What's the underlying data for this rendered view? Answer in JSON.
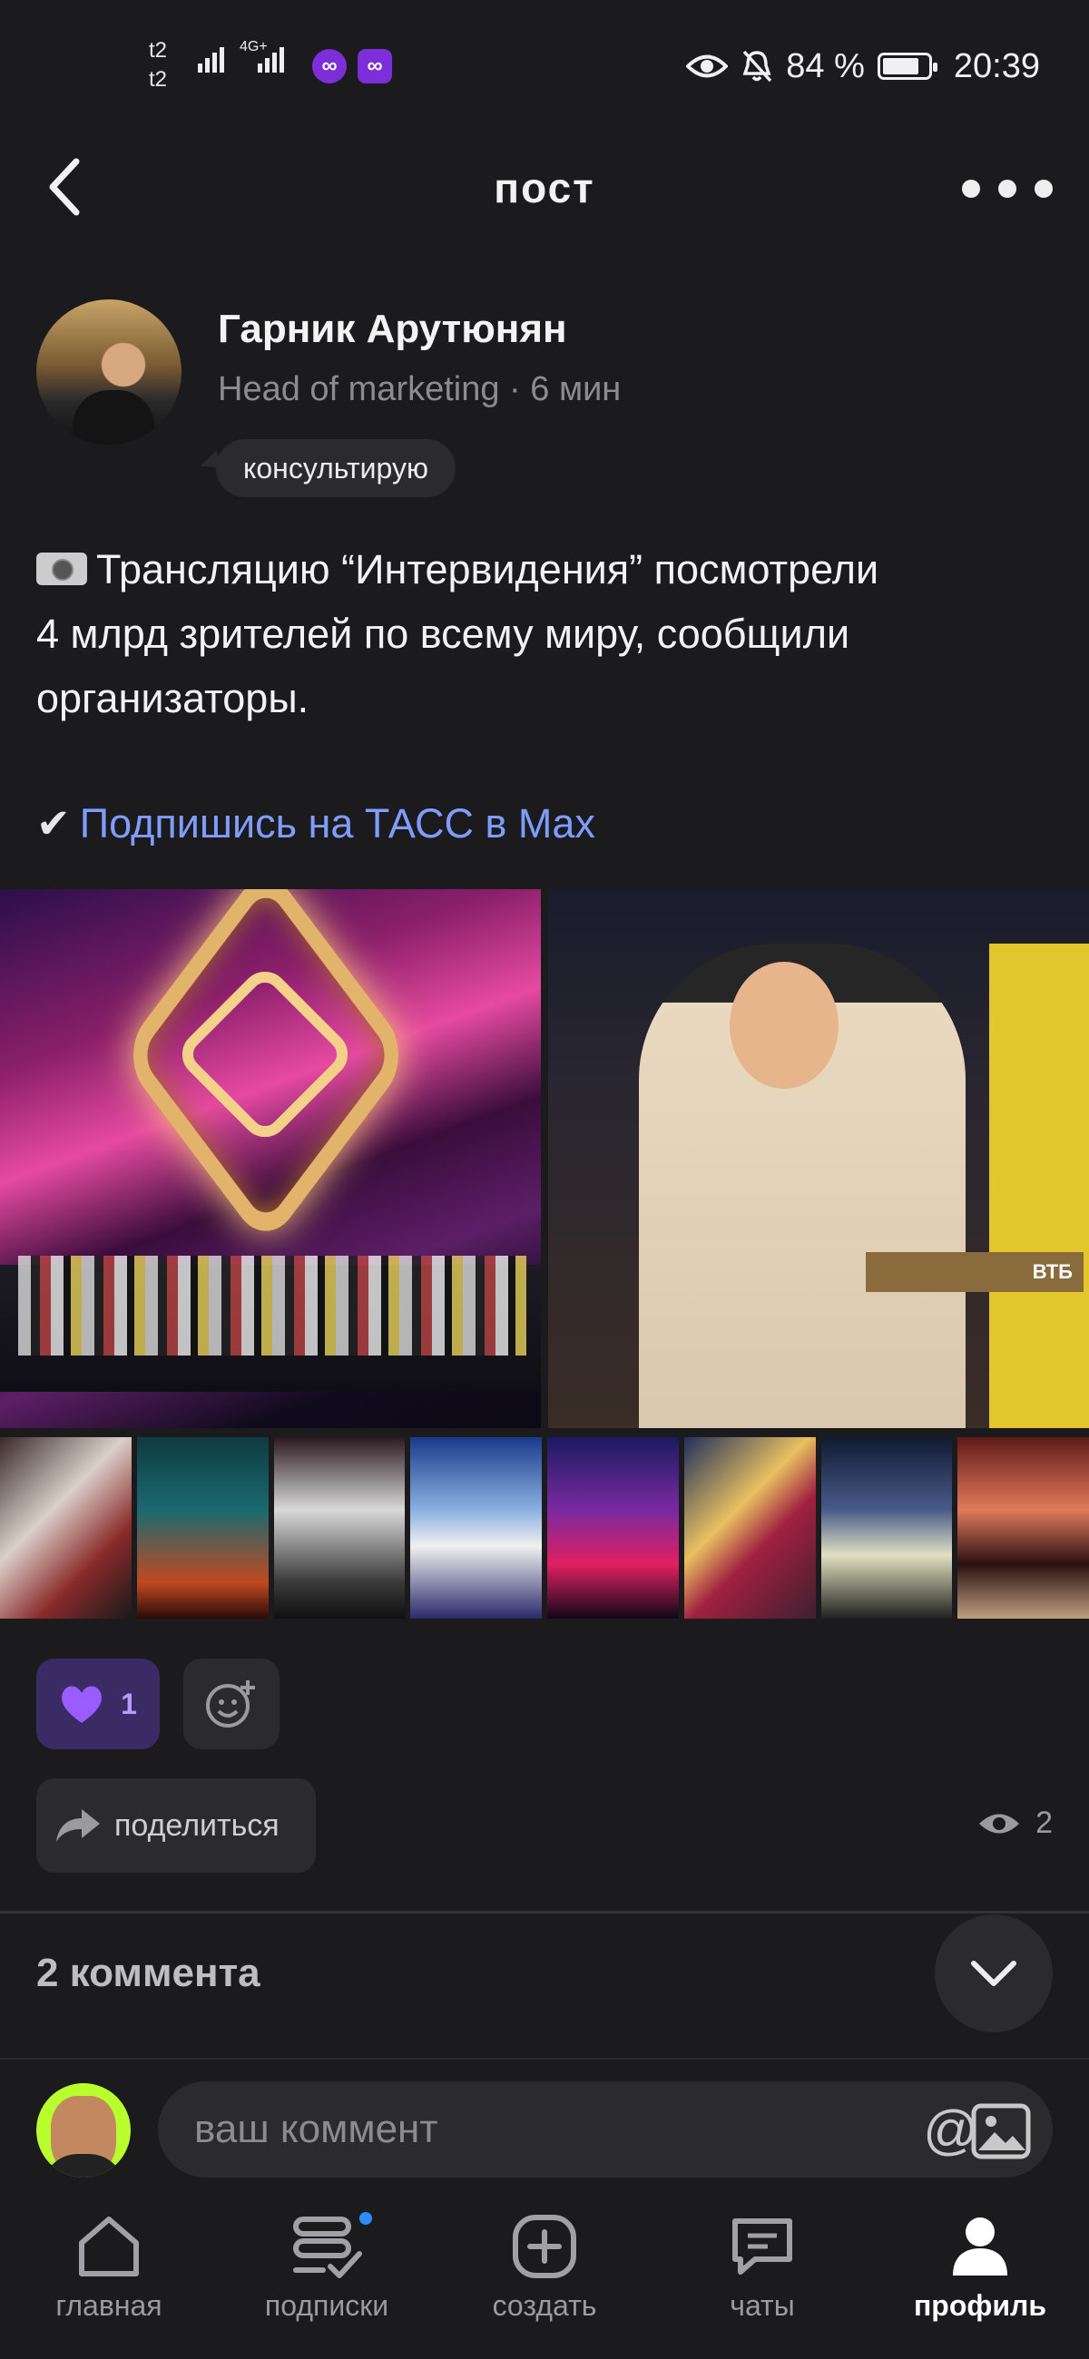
{
  "status_bar": {
    "carrier_1": "t2",
    "carrier_2": "t2",
    "network": "4G+",
    "battery_percent_text": "84 %",
    "battery_level": 0.84,
    "time": "20:39"
  },
  "header": {
    "title": "пост",
    "back_icon": "chevron-left-icon",
    "more_icon": "more-dots-icon"
  },
  "post": {
    "author_name": "Гарник Арутюнян",
    "author_meta": "Head of marketing · 6 мин",
    "badge": "консультирую",
    "text_lines": [
      "Трансляцию “Интервидения” посмотрели",
      "4 млрд зрителей по всему миру, сообщили",
      "организаторы."
    ],
    "check_mark": "✔",
    "link_text": "Подпишись на ТАСС в Max",
    "image_caption_tag": "ВТБ",
    "reaction_count": "1",
    "share_label": "поделиться",
    "views_count": "2"
  },
  "comments": {
    "title": "2 коммента",
    "input_placeholder": "ваш коммент",
    "at_symbol": "@"
  },
  "nav": {
    "items": [
      {
        "label": "главная",
        "icon": "home-icon"
      },
      {
        "label": "подписки",
        "icon": "subscriptions-icon"
      },
      {
        "label": "создать",
        "icon": "add-circle-icon"
      },
      {
        "label": "чаты",
        "icon": "chat-icon"
      },
      {
        "label": "профиль",
        "icon": "profile-icon"
      }
    ],
    "active": "профиль"
  },
  "colors": {
    "background": "#1b1b1d",
    "accent_link": "#7f9cff",
    "reaction_bg": "#3a2b64",
    "reaction_heart": "#9a5cff",
    "notification_dot": "#2f8cff"
  }
}
